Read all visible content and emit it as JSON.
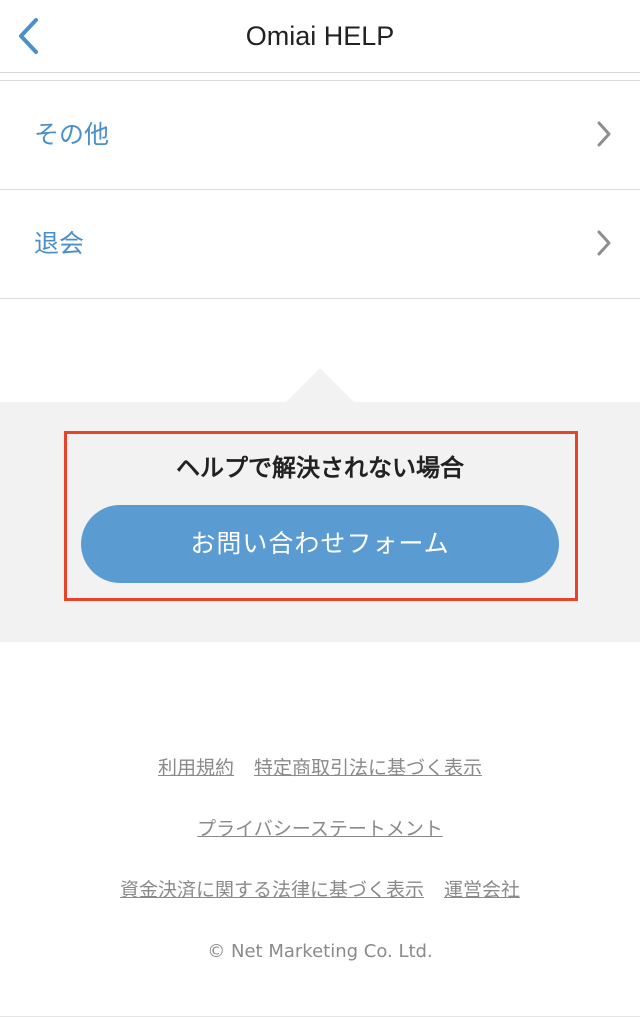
{
  "header": {
    "title": "Omiai HELP",
    "back_icon": "chevron-left-icon"
  },
  "list": {
    "items": [
      {
        "label": "その他"
      },
      {
        "label": "退会"
      }
    ],
    "chevron_icon": "chevron-right-icon"
  },
  "help": {
    "heading": "ヘルプで解決されない場合",
    "contact_button_label": "お問い合わせフォーム"
  },
  "footer": {
    "row1": [
      "利用規約",
      "特定商取引法に基づく表示"
    ],
    "row2": [
      "プライバシーステートメント"
    ],
    "row3": [
      "資金決済に関する法律に基づく表示",
      "運営会社"
    ],
    "copyright": "© Net Marketing Co. Ltd."
  },
  "colors": {
    "accent": "#4a8fc7",
    "button": "#5a9bd1",
    "highlight": "#e5432a",
    "panel": "#f2f2f2"
  }
}
